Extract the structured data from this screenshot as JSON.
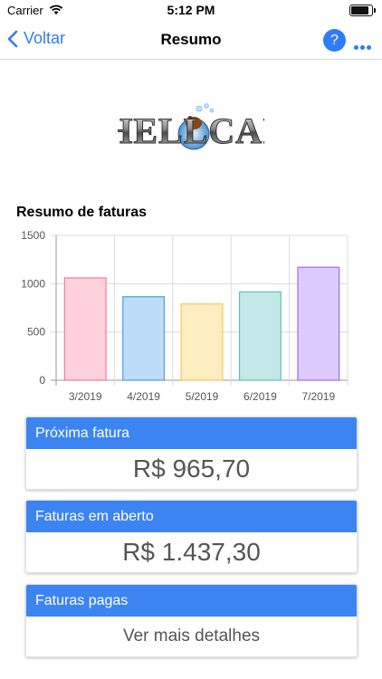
{
  "status": {
    "carrier": "Carrier",
    "time": "5:12 PM",
    "battery_level": 0.95
  },
  "nav": {
    "back_label": "Voltar",
    "title": "Resumo",
    "help_label": "?"
  },
  "logo": {
    "text": "HELLCAI"
  },
  "section_title": "Resumo de faturas",
  "chart_data": {
    "type": "bar",
    "categories": [
      "3/2019",
      "4/2019",
      "5/2019",
      "6/2019",
      "7/2019"
    ],
    "values": [
      1060,
      865,
      790,
      915,
      1170
    ],
    "ylim": [
      0,
      1500
    ],
    "yticks": [
      0,
      500,
      1000,
      1500
    ],
    "grid": true,
    "fill_colors": [
      "#ffd1dc",
      "#bcdcf7",
      "#fdedc1",
      "#c3e8e7",
      "#dccbfc"
    ],
    "border_colors": [
      "#f47a99",
      "#4aa1e0",
      "#f5c85e",
      "#5cc2c1",
      "#9e6cf5"
    ]
  },
  "cards": [
    {
      "header": "Próxima fatura",
      "value": "R$ 965,70"
    },
    {
      "header": "Faturas em aberto",
      "value": "R$ 1.437,30"
    },
    {
      "header": "Faturas pagas",
      "value": "Ver mais detalhes"
    }
  ]
}
